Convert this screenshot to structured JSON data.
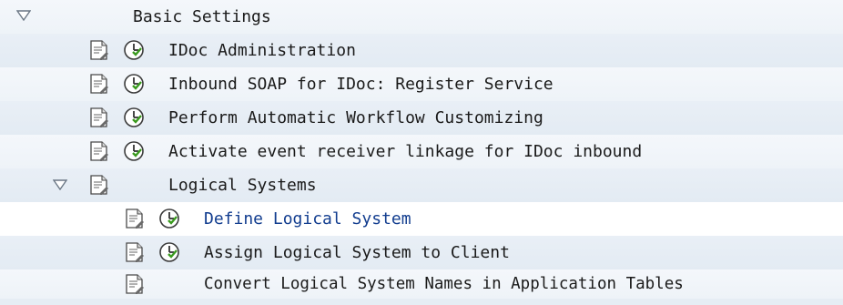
{
  "tree": {
    "root": {
      "label": "Basic Settings",
      "icon": "expanded-triangle-icon"
    },
    "items": [
      {
        "label": "IDoc Administration",
        "doc_icon": "document-icon",
        "exec_icon": "execute-clock-icon"
      },
      {
        "label": "Inbound SOAP for IDoc: Register Service",
        "doc_icon": "document-icon",
        "exec_icon": "execute-clock-icon"
      },
      {
        "label": "Perform Automatic Workflow Customizing",
        "doc_icon": "document-icon",
        "exec_icon": "execute-clock-icon"
      },
      {
        "label": "Activate event receiver linkage for IDoc inbound",
        "doc_icon": "document-icon",
        "exec_icon": "execute-clock-icon"
      }
    ],
    "subfolder": {
      "label": "Logical Systems",
      "icon": "expanded-triangle-icon",
      "items": [
        {
          "label": "Define Logical System",
          "selected": true
        },
        {
          "label": "Assign Logical System to Client"
        },
        {
          "label": "Convert Logical System Names in Application Tables"
        }
      ]
    }
  },
  "colors": {
    "selected_text": "#123d8f",
    "exec_green": "#3a9a1e"
  }
}
